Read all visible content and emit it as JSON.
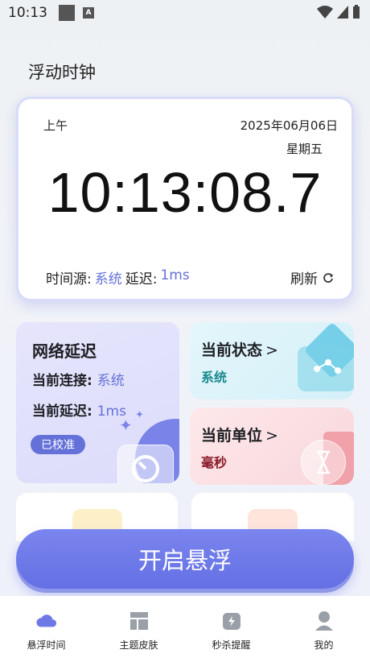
{
  "status_bar": {
    "time": "10:13",
    "notification_icon": "A"
  },
  "page_title": "浮动时钟",
  "clock": {
    "ampm": "上午",
    "date": "2025年06月06日",
    "weekday": "星期五",
    "time": "10:13:08.7",
    "source_label": "时间源:",
    "source_value": "系统",
    "delay_label": "延迟:",
    "delay_value": "1ms",
    "refresh_label": "刷新"
  },
  "network": {
    "title": "网络延迟",
    "connection_label": "当前连接:",
    "connection_value": "系统",
    "delay_label": "当前延迟:",
    "delay_value": "1ms",
    "badge": "已校准"
  },
  "state_card": {
    "title": "当前状态",
    "value": "系统"
  },
  "unit_card": {
    "title": "当前单位",
    "value": "毫秒"
  },
  "float_button": "开启悬浮",
  "nav": [
    {
      "label": "悬浮时间",
      "icon": "cloud-icon"
    },
    {
      "label": "主题皮肤",
      "icon": "layout-icon"
    },
    {
      "label": "秒杀提醒",
      "icon": "alarm-icon"
    },
    {
      "label": "我的",
      "icon": "user-icon"
    }
  ],
  "colors": {
    "accent": "#6471d8",
    "teal": "#1a8a8f",
    "maroon": "#8a1a2a"
  }
}
